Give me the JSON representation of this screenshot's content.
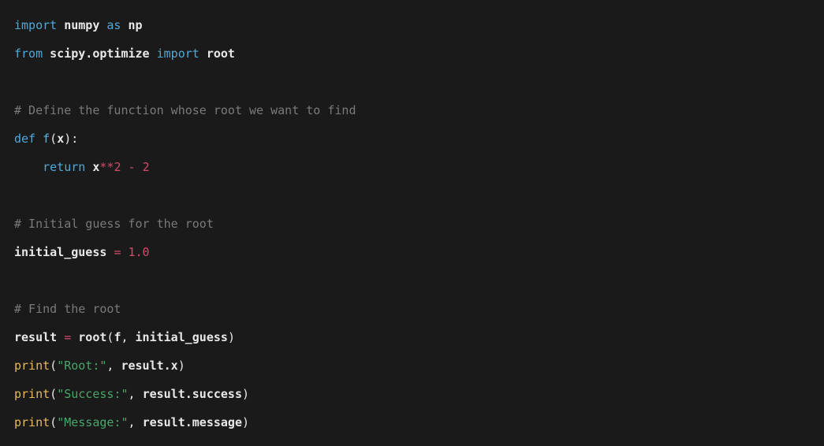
{
  "code": {
    "lines": [
      {
        "type": "code",
        "tokens": [
          {
            "t": "import",
            "c": "kw"
          },
          {
            "t": " ",
            "c": ""
          },
          {
            "t": "numpy",
            "c": "mod bold"
          },
          {
            "t": " ",
            "c": ""
          },
          {
            "t": "as",
            "c": "kw"
          },
          {
            "t": " ",
            "c": ""
          },
          {
            "t": "np",
            "c": "mod bold"
          }
        ]
      },
      {
        "type": "code",
        "tokens": [
          {
            "t": "from",
            "c": "kw"
          },
          {
            "t": " ",
            "c": ""
          },
          {
            "t": "scipy.optimize",
            "c": "mod bold"
          },
          {
            "t": " ",
            "c": ""
          },
          {
            "t": "import",
            "c": "kw"
          },
          {
            "t": " ",
            "c": ""
          },
          {
            "t": "root",
            "c": "mod bold"
          }
        ]
      },
      {
        "type": "blank"
      },
      {
        "type": "code",
        "tokens": [
          {
            "t": "# Define the function whose root we want to find",
            "c": "comment"
          }
        ]
      },
      {
        "type": "code",
        "tokens": [
          {
            "t": "def",
            "c": "kw"
          },
          {
            "t": " ",
            "c": ""
          },
          {
            "t": "f",
            "c": "defname"
          },
          {
            "t": "(",
            "c": "punct"
          },
          {
            "t": "x",
            "c": "ident"
          },
          {
            "t": ")",
            "c": "punct"
          },
          {
            "t": ":",
            "c": "punct"
          }
        ]
      },
      {
        "type": "code",
        "tokens": [
          {
            "t": "    ",
            "c": ""
          },
          {
            "t": "return",
            "c": "kw"
          },
          {
            "t": " ",
            "c": ""
          },
          {
            "t": "x",
            "c": "ident"
          },
          {
            "t": "**",
            "c": "op"
          },
          {
            "t": "2",
            "c": "num"
          },
          {
            "t": " ",
            "c": ""
          },
          {
            "t": "-",
            "c": "op"
          },
          {
            "t": " ",
            "c": ""
          },
          {
            "t": "2",
            "c": "num"
          }
        ]
      },
      {
        "type": "blank"
      },
      {
        "type": "code",
        "tokens": [
          {
            "t": "# Initial guess for the root",
            "c": "comment"
          }
        ]
      },
      {
        "type": "code",
        "tokens": [
          {
            "t": "initial_guess",
            "c": "ident bold"
          },
          {
            "t": " ",
            "c": ""
          },
          {
            "t": "=",
            "c": "op"
          },
          {
            "t": " ",
            "c": ""
          },
          {
            "t": "1.0",
            "c": "num"
          }
        ]
      },
      {
        "type": "blank"
      },
      {
        "type": "code",
        "tokens": [
          {
            "t": "# Find the root",
            "c": "comment"
          }
        ]
      },
      {
        "type": "code",
        "tokens": [
          {
            "t": "result",
            "c": "ident bold"
          },
          {
            "t": " ",
            "c": ""
          },
          {
            "t": "=",
            "c": "op"
          },
          {
            "t": " ",
            "c": ""
          },
          {
            "t": "root",
            "c": "ident"
          },
          {
            "t": "(",
            "c": "punct"
          },
          {
            "t": "f",
            "c": "ident"
          },
          {
            "t": ",",
            "c": "punct"
          },
          {
            "t": " ",
            "c": ""
          },
          {
            "t": "initial_guess",
            "c": "ident"
          },
          {
            "t": ")",
            "c": "punct"
          }
        ]
      },
      {
        "type": "code",
        "tokens": [
          {
            "t": "print",
            "c": "call"
          },
          {
            "t": "(",
            "c": "punct"
          },
          {
            "t": "\"Root:\"",
            "c": "str"
          },
          {
            "t": ",",
            "c": "punct"
          },
          {
            "t": " ",
            "c": ""
          },
          {
            "t": "result.x",
            "c": "ident"
          },
          {
            "t": ")",
            "c": "punct"
          }
        ]
      },
      {
        "type": "code",
        "tokens": [
          {
            "t": "print",
            "c": "call"
          },
          {
            "t": "(",
            "c": "punct"
          },
          {
            "t": "\"Success:\"",
            "c": "str"
          },
          {
            "t": ",",
            "c": "punct"
          },
          {
            "t": " ",
            "c": ""
          },
          {
            "t": "result.success",
            "c": "ident"
          },
          {
            "t": ")",
            "c": "punct"
          }
        ]
      },
      {
        "type": "code",
        "tokens": [
          {
            "t": "print",
            "c": "call"
          },
          {
            "t": "(",
            "c": "punct"
          },
          {
            "t": "\"Message:\"",
            "c": "str"
          },
          {
            "t": ",",
            "c": "punct"
          },
          {
            "t": " ",
            "c": ""
          },
          {
            "t": "result.message",
            "c": "ident"
          },
          {
            "t": ")",
            "c": "punct"
          }
        ]
      }
    ]
  }
}
